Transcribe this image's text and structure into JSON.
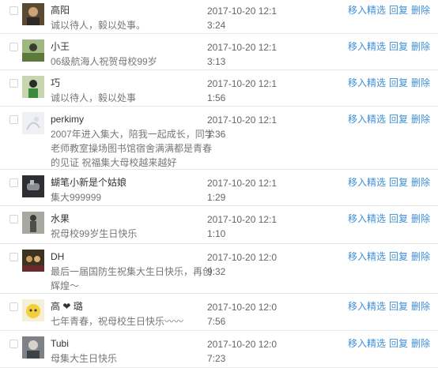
{
  "actions": {
    "feature_label": "移入精选",
    "reply_label": "回复",
    "delete_label": "删除"
  },
  "comments": [
    {
      "name": "高阳",
      "message": "诚以待人，毅以处事。",
      "time": "2017-10-20 12:13:24",
      "avatar": "avatar-portrait-dark"
    },
    {
      "name": "小王",
      "message": "06级航海人祝贺母校99岁",
      "time": "2017-10-20 12:13:13",
      "avatar": "avatar-outdoor-green"
    },
    {
      "name": "巧",
      "message": "诚以待人，毅以处事",
      "time": "2017-10-20 12:11:56",
      "avatar": "avatar-person-green"
    },
    {
      "name": "perkimy",
      "message": "2007年进入集大，陪我一起成长，同学老师教室操场图书馆宿舍满满都是青春的见证 祝福集大母校越来越好",
      "time": "2017-10-20 12:11:36",
      "avatar": "avatar-light-sketch"
    },
    {
      "name": "蝴笔小新是个姑娘",
      "message": "集大999999",
      "time": "2017-10-20 12:11:29",
      "avatar": "avatar-hand-dark"
    },
    {
      "name": "水果",
      "message": "祝母校99岁生日快乐",
      "time": "2017-10-20 12:11:10",
      "avatar": "avatar-figure-grey"
    },
    {
      "name": "DH",
      "message": "最后一届国防生祝集大生日快乐，再创辉煌～",
      "time": "2017-10-20 12:09:32",
      "avatar": "avatar-group-dark"
    },
    {
      "name": "高 ❤ 璐",
      "message": "七年青春，祝母校生日快乐〰〰",
      "time": "2017-10-20 12:07:56",
      "avatar": "avatar-cartoon-yellow"
    },
    {
      "name": "Tubi",
      "message": "母集大生日快乐",
      "time": "2017-10-20 12:07:23",
      "avatar": "avatar-portrait-grey"
    }
  ]
}
